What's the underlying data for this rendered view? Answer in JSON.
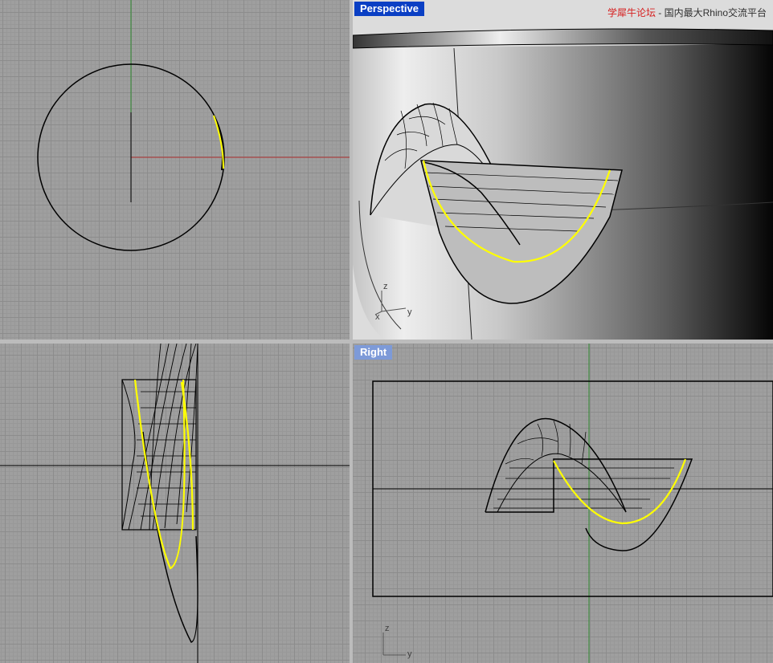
{
  "viewports": {
    "top": {
      "title": ""
    },
    "perspective": {
      "title": "Perspective"
    },
    "front": {
      "title": ""
    },
    "right": {
      "title": "Right"
    }
  },
  "watermark": {
    "site": "学犀牛论坛",
    "separator": " - ",
    "tagline": "国内最大Rhino交流平台"
  },
  "axis_labels": {
    "z": "z",
    "y": "y",
    "x": "x"
  },
  "colors": {
    "active_title": "#0a3fc4",
    "inactive_title": "#7d9ad8",
    "selection": "#ffff00",
    "x_axis": "#c03030",
    "y_axis": "#30a030"
  }
}
